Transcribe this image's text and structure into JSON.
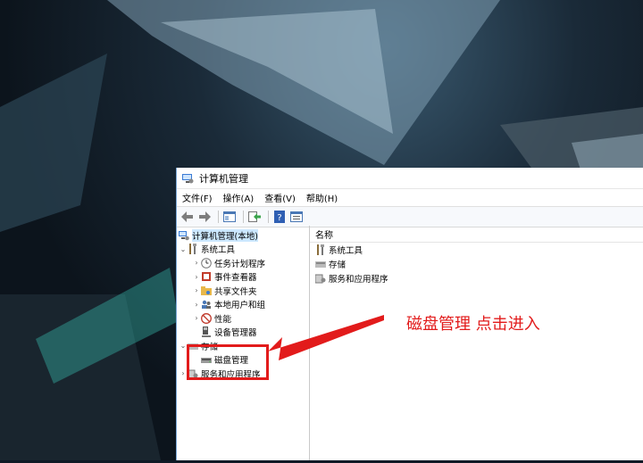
{
  "window": {
    "title": "计算机管理"
  },
  "menu": [
    "文件(F)",
    "操作(A)",
    "查看(V)",
    "帮助(H)"
  ],
  "toolbar": {
    "icons": [
      "back-arrow-icon",
      "forward-arrow-icon",
      "show-tree-icon",
      "export-icon",
      "help-icon",
      "properties-icon"
    ]
  },
  "tree": {
    "root": "计算机管理(本地)",
    "system_tools": "系统工具",
    "task_scheduler": "任务计划程序",
    "event_viewer": "事件查看器",
    "shared_folders": "共享文件夹",
    "local_users": "本地用户和组",
    "performance": "性能",
    "device_manager": "设备管理器",
    "storage": "存储",
    "disk_management": "磁盘管理",
    "services_apps": "服务和应用程序"
  },
  "list": {
    "column_name": "名称",
    "items": [
      "系统工具",
      "存储",
      "服务和应用程序"
    ]
  },
  "annotation": {
    "text": "磁盘管理  点击进入",
    "color": "#e21b1b"
  }
}
